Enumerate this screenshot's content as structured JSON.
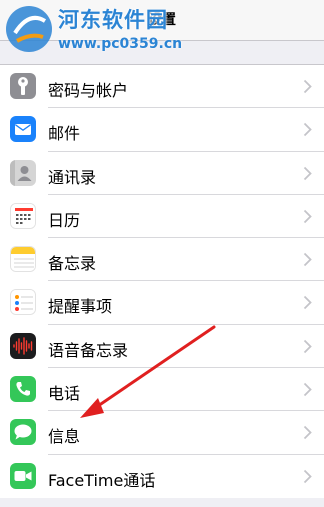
{
  "nav": {
    "title": "设置"
  },
  "watermark": {
    "name": "河东软件园",
    "url": "www.pc0359.cn"
  },
  "settings": [
    {
      "label": "密码与帐户",
      "icon": "key-icon",
      "color": "#8e8e93"
    },
    {
      "label": "邮件",
      "icon": "mail-icon",
      "color": "#1a82fb"
    },
    {
      "label": "通讯录",
      "icon": "contacts-icon",
      "color": "#bfbfbf"
    },
    {
      "label": "日历",
      "icon": "calendar-icon",
      "color": "#ffffff"
    },
    {
      "label": "备忘录",
      "icon": "notes-icon",
      "color": "#fecc2f"
    },
    {
      "label": "提醒事项",
      "icon": "reminders-icon",
      "color": "#ffffff"
    },
    {
      "label": "语音备忘录",
      "icon": "voice-memos-icon",
      "color": "#1c1c1e"
    },
    {
      "label": "电话",
      "icon": "phone-icon",
      "color": "#34c759"
    },
    {
      "label": "信息",
      "icon": "messages-icon",
      "color": "#34c759"
    },
    {
      "label": "FaceTime通话",
      "icon": "facetime-icon",
      "color": "#34c759"
    }
  ],
  "annotation": {
    "color": "#e02020",
    "target": "信息"
  }
}
